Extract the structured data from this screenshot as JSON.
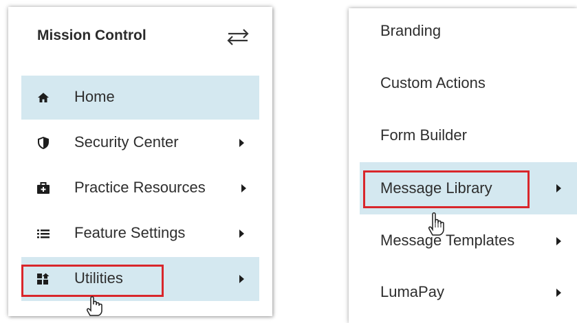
{
  "mission_control": {
    "title": "Mission Control",
    "toggle_icon": "swap-arrows-icon",
    "items": [
      {
        "label": "Home",
        "icon": "home-icon",
        "has_submenu": false,
        "selected": true
      },
      {
        "label": "Security Center",
        "icon": "shield-icon",
        "has_submenu": true,
        "selected": false
      },
      {
        "label": "Practice Resources",
        "icon": "medkit-icon",
        "has_submenu": true,
        "selected": false
      },
      {
        "label": "Feature Settings",
        "icon": "list-icon",
        "has_submenu": true,
        "selected": false
      },
      {
        "label": "Utilities",
        "icon": "utilities-grid-icon",
        "has_submenu": true,
        "selected": true,
        "highlighted": true
      }
    ]
  },
  "utilities_submenu": {
    "items": [
      {
        "label": "Branding",
        "has_submenu": false,
        "selected": false
      },
      {
        "label": "Custom Actions",
        "has_submenu": false,
        "selected": false
      },
      {
        "label": "Form Builder",
        "has_submenu": false,
        "selected": false
      },
      {
        "label": "Message Library",
        "has_submenu": true,
        "selected": true,
        "highlighted": true
      },
      {
        "label": "Message Templates",
        "has_submenu": true,
        "selected": false
      },
      {
        "label": "LumaPay",
        "has_submenu": true,
        "selected": false
      }
    ]
  },
  "colors": {
    "selected_bg": "#d4e8f0",
    "highlight_border": "#d9262b",
    "text": "#2e2e2e"
  }
}
